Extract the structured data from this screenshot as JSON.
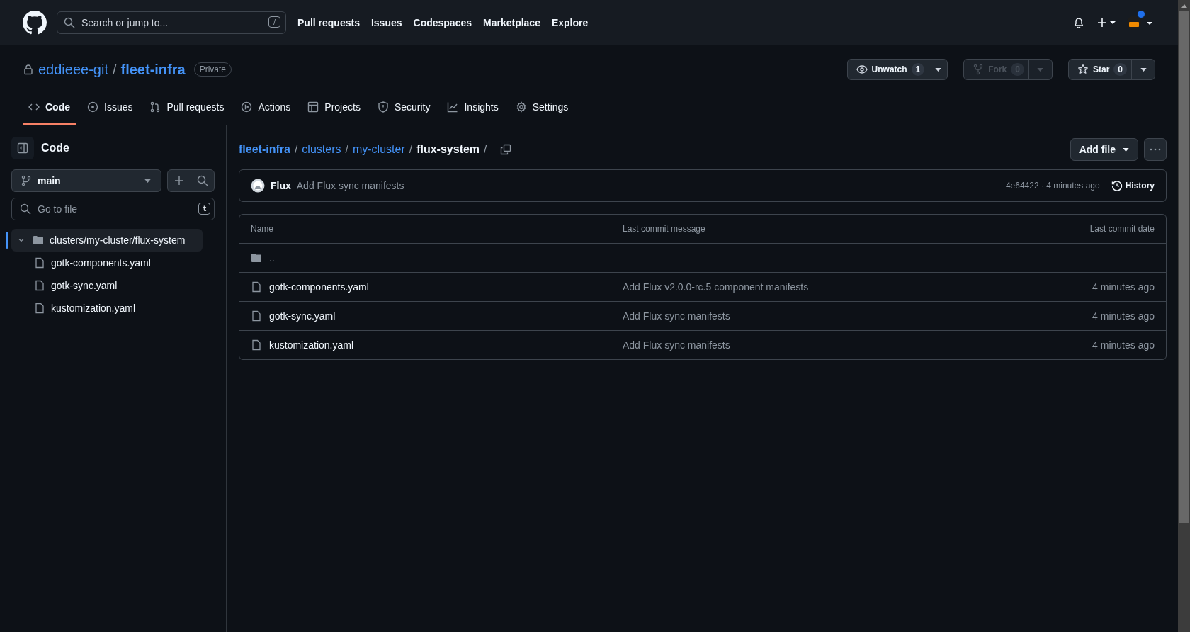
{
  "header": {
    "search_placeholder": "Search or jump to...",
    "search_shortcut": "/",
    "nav": [
      "Pull requests",
      "Issues",
      "Codespaces",
      "Marketplace",
      "Explore"
    ],
    "notification_dot": true
  },
  "repo": {
    "owner": "eddieee-git",
    "separator": "/",
    "name": "fleet-infra",
    "visibility": "Private",
    "actions": [
      {
        "kind": "watch",
        "label": "Unwatch",
        "count": "1",
        "disabled": false
      },
      {
        "kind": "fork",
        "label": "Fork",
        "count": "0",
        "disabled": true
      },
      {
        "kind": "star",
        "label": "Star",
        "count": "0",
        "disabled": false
      }
    ]
  },
  "tabs": [
    {
      "label": "Code",
      "kind": "code",
      "selected": true
    },
    {
      "label": "Issues",
      "kind": "issues",
      "selected": false
    },
    {
      "label": "Pull requests",
      "kind": "pulls",
      "selected": false
    },
    {
      "label": "Actions",
      "kind": "actions",
      "selected": false
    },
    {
      "label": "Projects",
      "kind": "projects",
      "selected": false
    },
    {
      "label": "Security",
      "kind": "security",
      "selected": false
    },
    {
      "label": "Insights",
      "kind": "insights",
      "selected": false
    },
    {
      "label": "Settings",
      "kind": "settings",
      "selected": false
    }
  ],
  "sidebar": {
    "title": "Code",
    "branch": "main",
    "file_search_placeholder": "Go to file",
    "file_search_shortcut": "t",
    "tree": [
      {
        "name": "clusters/my-cluster/flux-system",
        "kind": "folder",
        "expanded": true,
        "selected": true,
        "children": [
          {
            "name": "gotk-components.yaml",
            "kind": "file",
            "selected": false
          },
          {
            "name": "gotk-sync.yaml",
            "kind": "file",
            "selected": false
          },
          {
            "name": "kustomization.yaml",
            "kind": "file",
            "selected": false
          }
        ]
      }
    ]
  },
  "breadcrumb": [
    {
      "text": "fleet-infra",
      "kind": "link"
    },
    {
      "text": "/",
      "kind": "separator"
    },
    {
      "text": "clusters",
      "kind": "link"
    },
    {
      "text": "/",
      "kind": "separator"
    },
    {
      "text": "my-cluster",
      "kind": "link"
    },
    {
      "text": "/",
      "kind": "separator"
    },
    {
      "text": "flux-system",
      "kind": "current"
    },
    {
      "text": "/",
      "kind": "separator"
    }
  ],
  "add_file": "Add file",
  "latest_commit": {
    "author": "Flux",
    "message": "Add Flux sync manifests",
    "meta": "4e64422 · 4 minutes ago",
    "history": "History"
  },
  "table": {
    "columns": [
      "Name",
      "Last commit message",
      "Last commit date"
    ],
    "rows": [
      {
        "kind": "parent",
        "name": "..",
        "message": "",
        "date": ""
      },
      {
        "kind": "file",
        "name": "gotk-components.yaml",
        "message": "Add Flux v2.0.0-rc.5 component manifests",
        "date": "4 minutes ago"
      },
      {
        "kind": "file",
        "name": "gotk-sync.yaml",
        "message": "Add Flux sync manifests",
        "date": "4 minutes ago"
      },
      {
        "kind": "file",
        "name": "kustomization.yaml",
        "message": "Add Flux sync manifests",
        "date": "4 minutes ago"
      }
    ]
  }
}
